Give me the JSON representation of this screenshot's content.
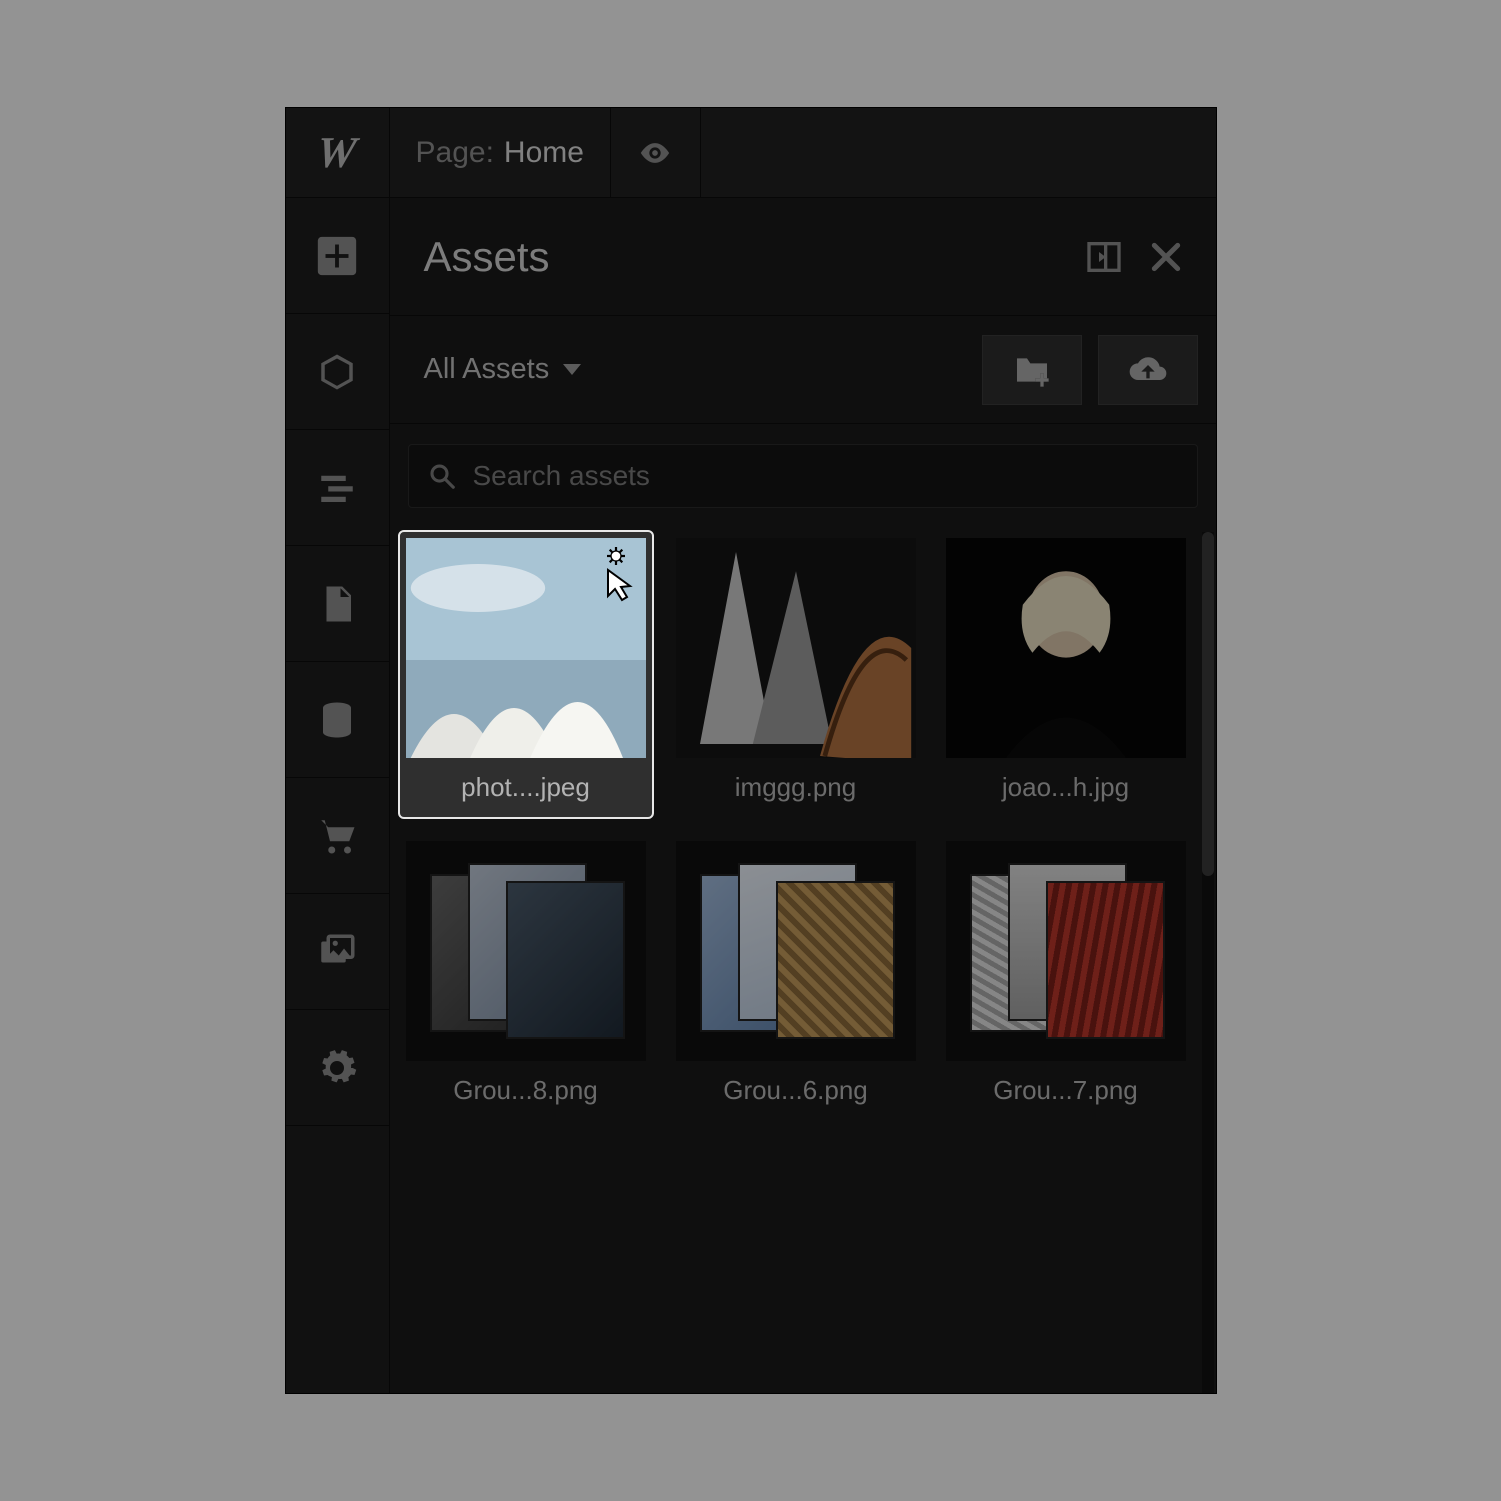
{
  "topbar": {
    "page_label": "Page:",
    "page_name": "Home"
  },
  "panel": {
    "title": "Assets",
    "filter_label": "All Assets",
    "search_placeholder": "Search assets"
  },
  "assets": [
    {
      "name": "phot....jpeg",
      "selected": true,
      "kind": "sydney"
    },
    {
      "name": "imggg.png",
      "selected": false,
      "kind": "arch1"
    },
    {
      "name": "joao...h.jpg",
      "selected": false,
      "kind": "portrait"
    },
    {
      "name": "Grou...8.png",
      "selected": false,
      "kind": "stack-grey"
    },
    {
      "name": "Grou...6.png",
      "selected": false,
      "kind": "stack-blue"
    },
    {
      "name": "Grou...7.png",
      "selected": false,
      "kind": "stack-red"
    }
  ]
}
